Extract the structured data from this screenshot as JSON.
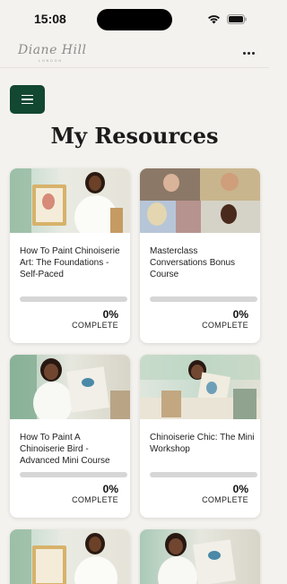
{
  "status_bar": {
    "time": "15:08"
  },
  "header": {
    "logo": "Diane Hill",
    "logo_sub": "LONDON"
  },
  "page": {
    "title": "My Resources"
  },
  "courses": [
    {
      "title": "How To Paint Chinoiserie Art: The Foundations - Self-Paced",
      "progress": 0,
      "progress_text": "0%",
      "complete_label": "COMPLETE",
      "thumbnail": "teacher-with-framed-art"
    },
    {
      "title": "Masterclass Conversations Bonus Course",
      "progress": 0,
      "progress_text": "0%",
      "complete_label": "COMPLETE",
      "thumbnail": "video-call-grid"
    },
    {
      "title": "How To Paint A Chinoiserie Bird - Advanced Mini Course",
      "progress": 0,
      "progress_text": "0%",
      "complete_label": "COMPLETE",
      "thumbnail": "teacher-with-bird-painting"
    },
    {
      "title": "Chinoiserie Chic: The Mini Workshop",
      "progress": 0,
      "progress_text": "0%",
      "complete_label": "COMPLETE",
      "thumbnail": "teacher-with-painting-studio"
    },
    {
      "title": "",
      "progress": 0,
      "progress_text": "",
      "complete_label": "",
      "thumbnail": "teacher-with-framed-art"
    },
    {
      "title": "",
      "progress": 0,
      "progress_text": "",
      "complete_label": "",
      "thumbnail": "teacher-with-bird-painting"
    }
  ],
  "colors": {
    "accent": "#124731",
    "background": "#f4f2ee",
    "track": "#d6d6d6"
  }
}
